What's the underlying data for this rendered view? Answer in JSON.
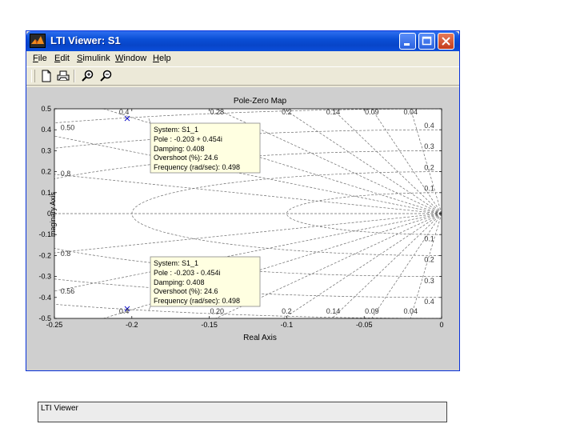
{
  "window": {
    "title": "LTI Viewer: S1"
  },
  "menu": [
    "File",
    "Edit",
    "Simulink",
    "Window",
    "Help"
  ],
  "toolbar": {
    "icons": [
      "new-document-icon",
      "print-icon",
      "zoom-in-icon",
      "zoom-out-icon"
    ]
  },
  "plot": {
    "title": "Pole-Zero Map",
    "xlabel": "Real Axis",
    "ylabel": "maginary Axis",
    "x_ticks": [
      "-0.25",
      "-0.2",
      "-0.15",
      "-0.1",
      "-0.05",
      "0"
    ],
    "y_ticks": [
      "0.5",
      "0.4",
      "0.3",
      "0.2",
      "0.1",
      "0",
      "-0.1",
      "-0.2",
      "-0.3",
      "-0.4",
      "-0.5"
    ],
    "damping_labels_left": [
      "0.50",
      "0.8",
      "0.8",
      "0.56"
    ],
    "top_labels": [
      "0.4",
      "0.28",
      "0.2",
      "0.14",
      "0.09",
      "0.04"
    ],
    "bottom_labels": [
      "0.4",
      "0.20",
      "0.2",
      "0.14",
      "0.09",
      "0.04"
    ],
    "right_labels": [
      "0.4",
      "0.3",
      "0.2",
      "0.1",
      "0.1",
      "0.2",
      "0.3",
      "0.4"
    ]
  },
  "chart_data": {
    "type": "scatter",
    "title": "Pole-Zero Map",
    "xlabel": "Real Axis",
    "ylabel": "maginary Axis",
    "xlim": [
      -0.25,
      0
    ],
    "ylim": [
      -0.5,
      0.5
    ],
    "grid": true,
    "series": [
      {
        "name": "Pole",
        "x": [
          -0.203,
          -0.203
        ],
        "y": [
          0.454,
          -0.454
        ],
        "marker": "x"
      }
    ]
  },
  "datatips": [
    {
      "lines": [
        "System: S1_1",
        "Pole : -0.203 + 0.454i",
        "Damping: 0.408",
        "Overshoot (%): 24.6",
        "Frequency (rad/sec): 0.498"
      ]
    },
    {
      "lines": [
        "System: S1_1",
        "Pole : -0.203 - 0.454i",
        "Damping: 0.408",
        "Overshoot (%): 24.6",
        "Frequency (rad/sec): 0.498"
      ]
    }
  ],
  "status": {
    "text": "LTI Viewer"
  },
  "colors": {
    "titlebar": "#0a4fd6",
    "plot_bg": "#ffffff",
    "figure_bg": "#cfcfcf",
    "datatip_bg": "#ffffe1"
  }
}
